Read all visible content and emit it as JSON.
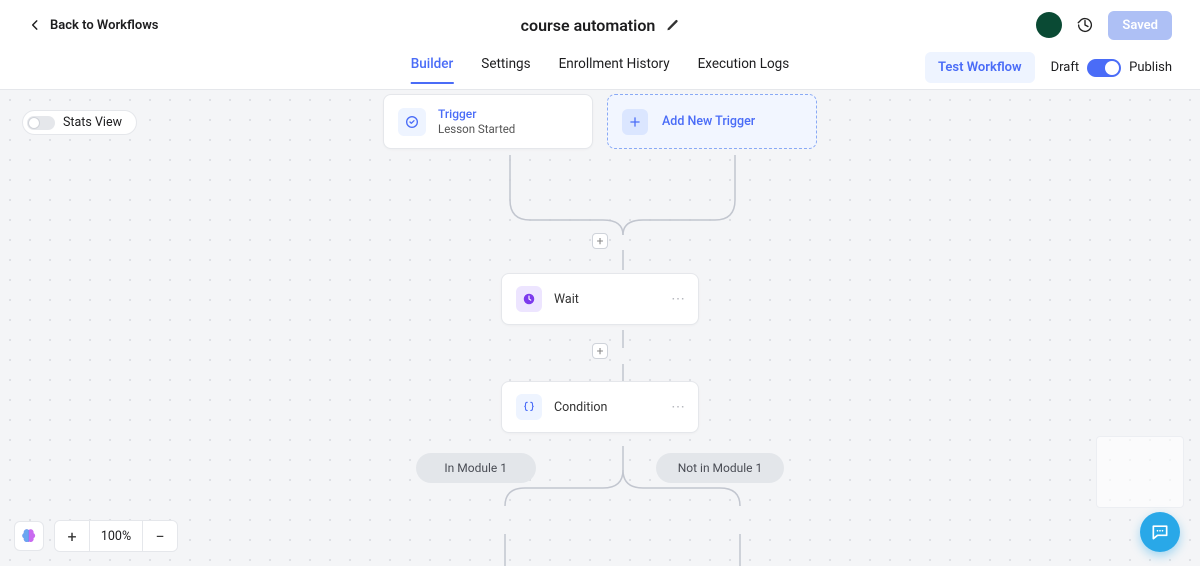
{
  "header": {
    "back_label": "Back to Workflows",
    "title": "course automation",
    "saved_label": "Saved"
  },
  "tabs": {
    "items": [
      {
        "label": "Builder",
        "active": true
      },
      {
        "label": "Settings"
      },
      {
        "label": "Enrollment History"
      },
      {
        "label": "Execution Logs"
      }
    ],
    "test_label": "Test Workflow",
    "draft_label": "Draft",
    "publish_label": "Publish",
    "publish_on": true
  },
  "canvas": {
    "stats_label": "Stats View",
    "zoom_pct": "100%"
  },
  "flow": {
    "trigger": {
      "label": "Trigger",
      "sub": "Lesson Started"
    },
    "add_trigger_label": "Add New Trigger",
    "steps": [
      {
        "kind": "wait",
        "label": "Wait"
      },
      {
        "kind": "condition",
        "label": "Condition"
      }
    ],
    "branches": [
      "In Module 1",
      "Not in Module 1"
    ]
  }
}
